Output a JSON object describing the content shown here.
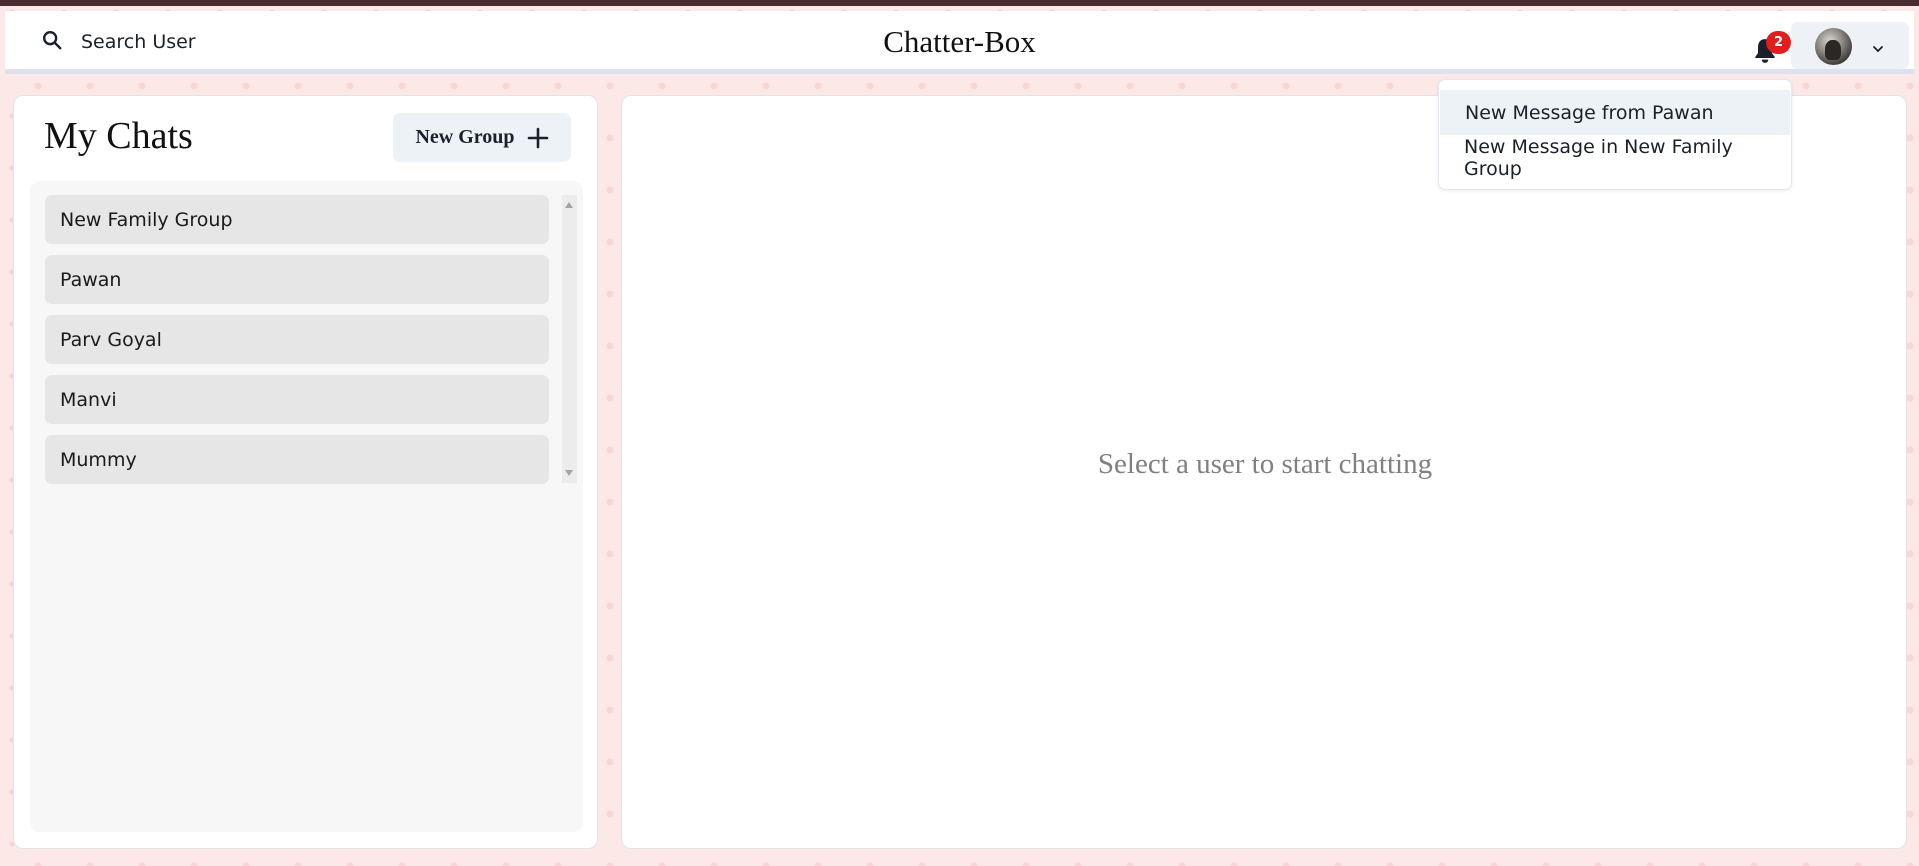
{
  "header": {
    "search_label": "Search User",
    "app_title": "Chatter-Box",
    "notification_count": "2"
  },
  "sidebar": {
    "title": "My Chats",
    "new_group_label": "New Group",
    "chats": [
      {
        "name": "New Family Group"
      },
      {
        "name": "Pawan"
      },
      {
        "name": "Parv Goyal"
      },
      {
        "name": "Manvi"
      },
      {
        "name": "Mummy"
      }
    ]
  },
  "main": {
    "placeholder": "Select a user to start chatting"
  },
  "notifications": {
    "items": [
      {
        "text": "New Message from Pawan"
      },
      {
        "text": "New Message in New Family Group"
      }
    ]
  },
  "colors": {
    "background": "#fde8e8",
    "badge": "#e01e1e",
    "top_strip": "#4a2c30"
  },
  "icons": [
    "search-icon",
    "bell-icon",
    "avatar",
    "chevron-down-icon",
    "plus-icon"
  ]
}
